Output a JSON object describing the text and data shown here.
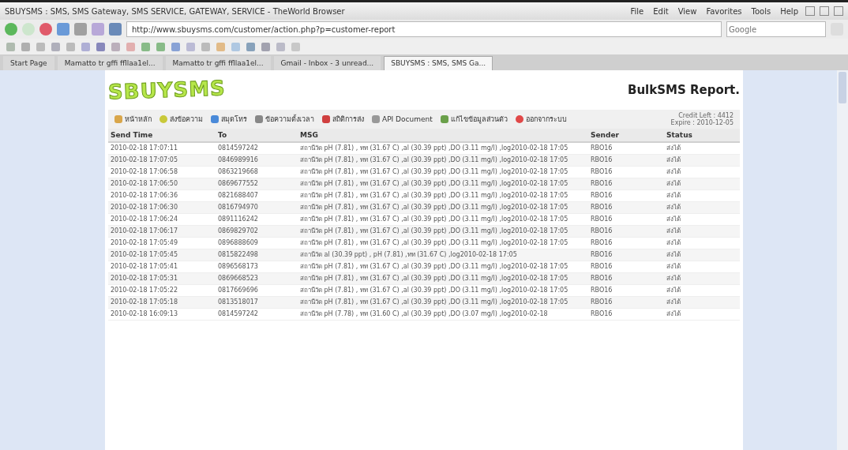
{
  "window": {
    "title": "SBUYSMS : SMS, SMS Gateway, SMS SERVICE, GATEWAY, SERVICE - TheWorld Browser",
    "menu": [
      "File",
      "Edit",
      "View",
      "Favorites",
      "Tools",
      "Help"
    ]
  },
  "address": {
    "url": "http://www.sbuysms.com/customer/action.php?p=customer-report"
  },
  "search": {
    "placeholder": "Google"
  },
  "tabs": [
    {
      "label": "Start Page",
      "selected": false
    },
    {
      "label": "Mamatto tr gffi ffllaa1el...",
      "selected": false
    },
    {
      "label": "Mamatto tr gffi ffllaa1el...",
      "selected": false
    },
    {
      "label": "Gmail - Inbox - 3 unread...",
      "selected": false
    },
    {
      "label": "SBUYSMS : SMS, SMS Ga...",
      "selected": true
    }
  ],
  "page": {
    "logo": "SBUYSMS",
    "heading": "BulkSMS Report.",
    "nav": [
      "หน้าหลัก",
      "ส่งข้อความ",
      "สมุดโทร",
      "ข้อความตั้งเวลา",
      "สถิติการส่ง",
      "API Document",
      "แก้ไขข้อมูลส่วนตัว",
      "ออกจากระบบ"
    ],
    "credit": "Credit Left : 4412",
    "expire": "Expire : 2010-12-05"
  },
  "table": {
    "columns": [
      "Send Time",
      "To",
      "MSG",
      "Sender",
      "Status"
    ],
    "rows": [
      [
        "2010-02-18 17:07:11",
        "0814597242",
        "สถานีวัด pH (7.81) , ทท (31.67 C) ,al (30.39 ppt) ,DO (3.11 mg/l) ,log2010-02-18 17:05",
        "RBO16",
        "ส่งได้"
      ],
      [
        "2010-02-18 17:07:05",
        "0846989916",
        "สถานีวัด pH (7.81) , ทท (31.67 C) ,al (30.39 ppt) ,DO (3.11 mg/l) ,log2010-02-18 17:05",
        "RBO16",
        "ส่งได้"
      ],
      [
        "2010-02-18 17:06:58",
        "0863219668",
        "สถานีวัด pH (7.81) , ทท (31.67 C) ,al (30.39 ppt) ,DO (3.11 mg/l) ,log2010-02-18 17:05",
        "RBO16",
        "ส่งได้"
      ],
      [
        "2010-02-18 17:06:50",
        "0869677552",
        "สถานีวัด pH (7.81) , ทท (31.67 C) ,al (30.39 ppt) ,DO (3.11 mg/l) ,log2010-02-18 17:05",
        "RBO16",
        "ส่งได้"
      ],
      [
        "2010-02-18 17:06:36",
        "0821688407",
        "สถานีวัด pH (7.81) , ทท (31.67 C) ,al (30.39 ppt) ,DO (3.11 mg/l) ,log2010-02-18 17:05",
        "RBO16",
        "ส่งได้"
      ],
      [
        "2010-02-18 17:06:30",
        "0816794970",
        "สถานีวัด pH (7.81) , ทท (31.67 C) ,al (30.39 ppt) ,DO (3.11 mg/l) ,log2010-02-18 17:05",
        "RBO16",
        "ส่งได้"
      ],
      [
        "2010-02-18 17:06:24",
        "0891116242",
        "สถานีวัด pH (7.81) , ทท (31.67 C) ,al (30.39 ppt) ,DO (3.11 mg/l) ,log2010-02-18 17:05",
        "RBO16",
        "ส่งได้"
      ],
      [
        "2010-02-18 17:06:17",
        "0869829702",
        "สถานีวัด pH (7.81) , ทท (31.67 C) ,al (30.39 ppt) ,DO (3.11 mg/l) ,log2010-02-18 17:05",
        "RBO16",
        "ส่งได้"
      ],
      [
        "2010-02-18 17:05:49",
        "0896888609",
        "สถานีวัด pH (7.81) , ทท (31.67 C) ,al (30.39 ppt) ,DO (3.11 mg/l) ,log2010-02-18 17:05",
        "RBO16",
        "ส่งได้"
      ],
      [
        "2010-02-18 17:05:45",
        "0815822498",
        "สถานีวัด al (30.39 ppt) , pH (7.81) ,ทท (31.67 C) ,log2010-02-18 17:05",
        "RBO16",
        "ส่งได้"
      ],
      [
        "2010-02-18 17:05:41",
        "0896568173",
        "สถานีวัด pH (7.81) , ทท (31.67 C) ,al (30.39 ppt) ,DO (3.11 mg/l) ,log2010-02-18 17:05",
        "RBO16",
        "ส่งได้"
      ],
      [
        "2010-02-18 17:05:31",
        "0869668523",
        "สถานีวัด pH (7.81) , ทท (31.67 C) ,al (30.39 ppt) ,DO (3.11 mg/l) ,log2010-02-18 17:05",
        "RBO16",
        "ส่งได้"
      ],
      [
        "2010-02-18 17:05:22",
        "0817669696",
        "สถานีวัด pH (7.81) , ทท (31.67 C) ,al (30.39 ppt) ,DO (3.11 mg/l) ,log2010-02-18 17:05",
        "RBO16",
        "ส่งได้"
      ],
      [
        "2010-02-18 17:05:18",
        "0813518017",
        "สถานีวัด pH (7.81) , ทท (31.67 C) ,al (30.39 ppt) ,DO (3.11 mg/l) ,log2010-02-18 17:05",
        "RBO16",
        "ส่งได้"
      ],
      [
        "2010-02-18 16:09:13",
        "0814597242",
        "สถานีวัด pH (7.78) , ทท (31.60 C) ,al (30.39 ppt) ,DO (3.07 mg/l) ,log2010-02-18",
        "RBO16",
        "ส่งได้"
      ]
    ]
  }
}
